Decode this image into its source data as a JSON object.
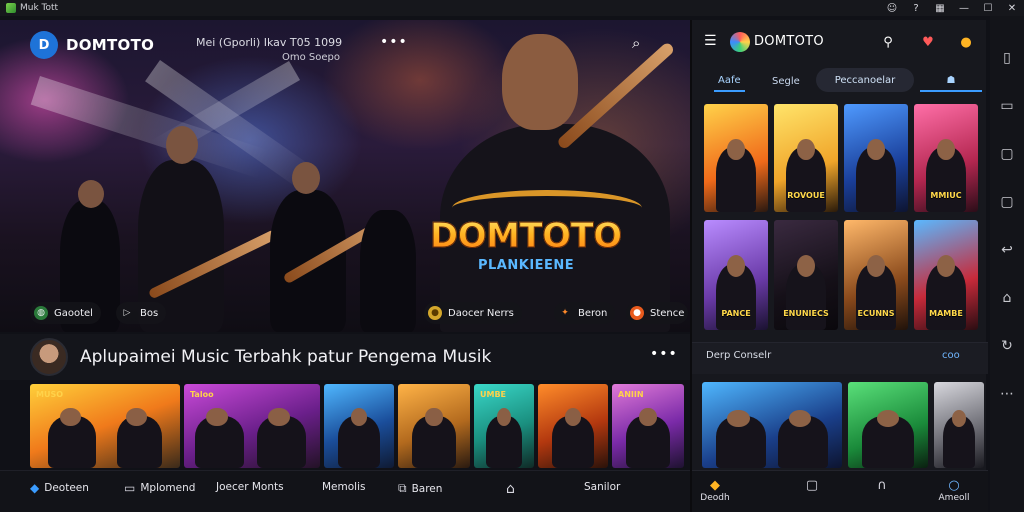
{
  "window": {
    "title": "Muk Tott"
  },
  "titlebar_icons": [
    "profile-icon",
    "help-icon",
    "layout-icon",
    "minimize-icon",
    "maximize-icon",
    "close-icon"
  ],
  "hero": {
    "brand_name": "DOMTOTO",
    "subtitle_line1": "Mei (Gporli) Ikav T05 1099",
    "subtitle_line2": "Omo Soepo",
    "logo_title": "DOMTOTO",
    "logo_subtitle": "PLANKIEENE",
    "chips": [
      {
        "label": "Gaootel",
        "icon": "globe-icon"
      },
      {
        "label": "Bos",
        "icon": "play-icon"
      },
      {
        "label": "Daocer Nerrs",
        "icon": "coin-icon"
      },
      {
        "label": "Beron",
        "icon": "fire-icon"
      },
      {
        "label": "Stence",
        "icon": "flame-icon"
      }
    ]
  },
  "section": {
    "title": "Aplupaimei Music Terbahk patur Pengema Musik"
  },
  "cards": [
    {
      "tag": "MUSO"
    },
    {
      "tag": "Taloo"
    },
    {
      "tag": ""
    },
    {
      "tag": ""
    },
    {
      "tag": "UMBE"
    },
    {
      "tag": ""
    },
    {
      "tag": "ANIIN"
    }
  ],
  "bottom_nav": [
    {
      "label": "Deoteen",
      "icon": "home-icon"
    },
    {
      "label": "Mplomend",
      "icon": "monitor-icon"
    },
    {
      "label": "Joecer Monts",
      "icon": ""
    },
    {
      "label": "Memolis",
      "icon": ""
    },
    {
      "label": "Baren",
      "icon": "library-icon"
    },
    {
      "label": "",
      "icon": "house-icon"
    },
    {
      "label": "Sanilor",
      "icon": ""
    }
  ],
  "right_panel": {
    "brand_name": "DOMTOTO",
    "tabs": [
      {
        "label": "Aafe"
      },
      {
        "label": "Segle"
      },
      {
        "label": "Peccanoelar"
      },
      {
        "label": ""
      }
    ],
    "tiles_row1": [
      "",
      "ROVOUE",
      "",
      "MMIUC"
    ],
    "tiles_row2": [
      "PANCE",
      "ENUNIECS",
      "ECUNNS",
      "MAMBE"
    ],
    "section_title": "Derp Conselr",
    "section_more": "coo",
    "bottom_nav": [
      {
        "label": "Deodh",
        "icon": "star-icon"
      },
      {
        "label": "",
        "icon": "bookmark-icon"
      },
      {
        "label": "",
        "icon": "headphones-icon"
      },
      {
        "label": "Ameoll",
        "icon": "profile-icon"
      }
    ]
  },
  "colors": {
    "accent": "#3b9cff",
    "logo_gold": "#ffb423",
    "background": "#101117"
  }
}
